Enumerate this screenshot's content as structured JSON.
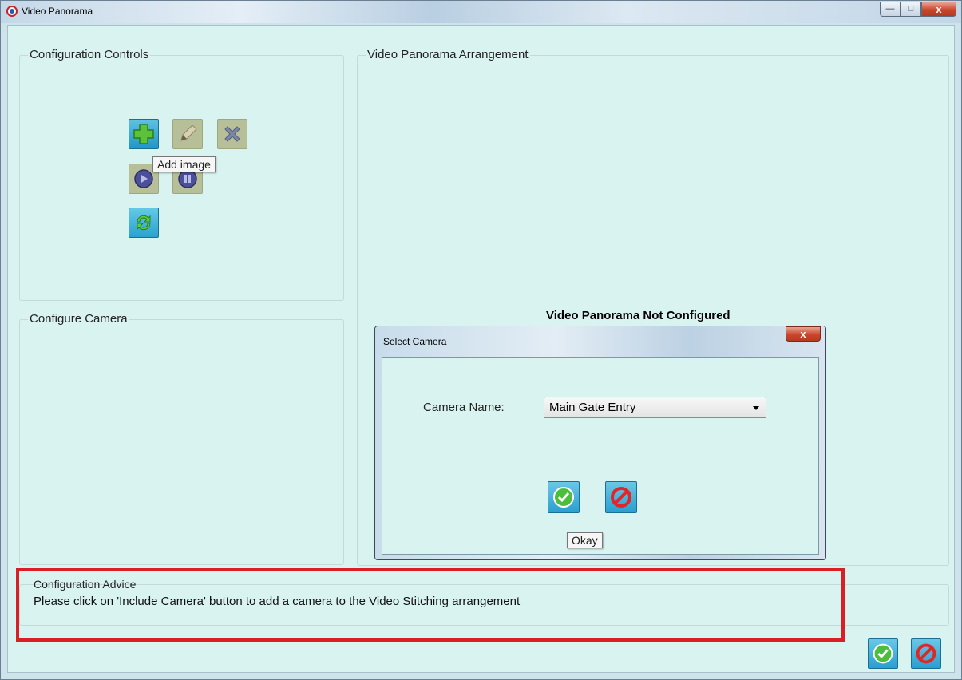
{
  "window": {
    "title": "Video Panorama",
    "min_glyph": "—",
    "max_glyph": "□",
    "close_glyph": "x"
  },
  "config_controls": {
    "label": "Configuration Controls",
    "tooltip": "Add image"
  },
  "configure_camera": {
    "label": "Configure Camera"
  },
  "arrangement": {
    "label": "Video Panorama Arrangement",
    "status": "Video Panorama Not Configured"
  },
  "dialog": {
    "title": "Select Camera",
    "close_glyph": "x",
    "camera_label": "Camera Name:",
    "camera_value": "Main Gate Entry",
    "ok_tooltip": "Okay"
  },
  "advice": {
    "label": "Configuration Advice",
    "text": "Please click on 'Include Camera' button to add a camera to the Video Stitching arrangement"
  },
  "colors": {
    "highlight": "#d81f26",
    "background": "#d9f3f1"
  }
}
